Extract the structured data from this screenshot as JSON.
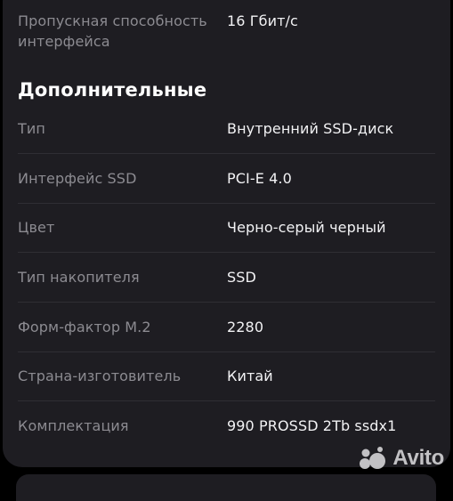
{
  "specs_top": {
    "label": "Пропускная способность интерфейса",
    "value": "16 Гбит/с"
  },
  "section": {
    "title": "Дополнительные"
  },
  "specs": [
    {
      "label": "Тип",
      "value": "Внутренний SSD-диск"
    },
    {
      "label": "Интерфейс SSD",
      "value": "PCI-E 4.0"
    },
    {
      "label": "Цвет",
      "value": "Черно-серый черный"
    },
    {
      "label": "Тип накопителя",
      "value": "SSD"
    },
    {
      "label": "Форм-фактор M.2",
      "value": "2280"
    },
    {
      "label": "Страна-изготовитель",
      "value": "Китай"
    },
    {
      "label": "Комплектация",
      "value": "990 PROSSD 2Tb ssdx1"
    }
  ],
  "watermark": {
    "text": "Avito",
    "icon": "avito-logo-icon"
  },
  "colors": {
    "background": "#000000",
    "card": "#1e1d22",
    "label": "#8c8b91",
    "value": "#f2f2f4",
    "title": "#ffffff"
  }
}
